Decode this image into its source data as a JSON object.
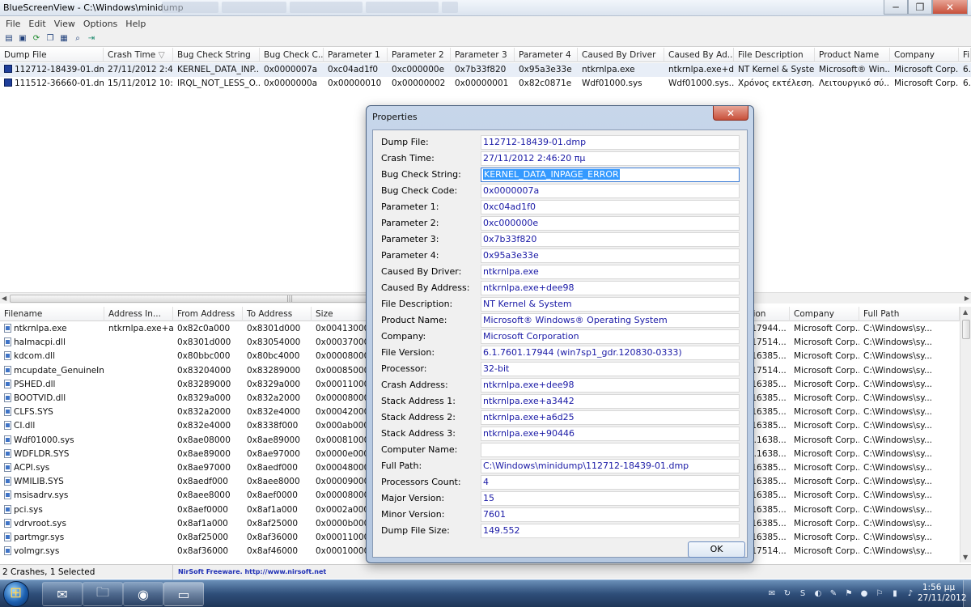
{
  "window": {
    "title": "BlueScreenView  -  C:\\Windows\\minidump",
    "minimize_glyph": "─",
    "maximize_glyph": "❐",
    "close_glyph": "✕"
  },
  "menu": [
    "File",
    "Edit",
    "View",
    "Options",
    "Help"
  ],
  "toolbar_icons": [
    "html-report-icon",
    "save-icon",
    "refresh-icon",
    "copy-icon",
    "properties-icon",
    "find-icon",
    "exit-icon"
  ],
  "upper_list": {
    "columns": [
      "Dump File",
      "Crash Time",
      "Bug Check String",
      "Bug Check C...",
      "Parameter 1",
      "Parameter 2",
      "Parameter 3",
      "Parameter 4",
      "Caused By Driver",
      "Caused By Ad...",
      "File Description",
      "Product Name",
      "Company",
      "Fi"
    ],
    "rows": [
      [
        "112712-18439-01.dmp",
        "27/11/2012 2:4...",
        "KERNEL_DATA_INP...",
        "0x0000007a",
        "0xc04ad1f0",
        "0xc000000e",
        "0x7b33f820",
        "0x95a3e33e",
        "ntkrnlpa.exe",
        "ntkrnlpa.exe+d...",
        "NT Kernel & Syste...",
        "Microsoft® Win...",
        "Microsoft Corp...",
        "6."
      ],
      [
        "111512-36660-01.dmp",
        "15/11/2012 10:...",
        "IRQL_NOT_LESS_O...",
        "0x0000000a",
        "0x00000010",
        "0x00000002",
        "0x00000001",
        "0x82c0871e",
        "Wdf01000.sys",
        "Wdf01000.sys...",
        "Χρόνος εκτέλεση...",
        "Λειτουργικό σύ...",
        "Microsoft Corp...",
        "6."
      ]
    ]
  },
  "hscroll_grip": "|||",
  "lower_list": {
    "columns": [
      "Filename",
      "Address In...",
      "From Address",
      "To Address",
      "Size",
      "sion",
      "Company",
      "Full Path"
    ],
    "rows": [
      [
        "ntkrnlpa.exe",
        "ntkrnlpa.exe+a...",
        "0x82c0a000",
        "0x8301d000",
        "0x00413000",
        ".17944...",
        "Microsoft Corp...",
        "C:\\Windows\\sy..."
      ],
      [
        "halmacpi.dll",
        "",
        "0x8301d000",
        "0x83054000",
        "0x00037000",
        ".17514...",
        "Microsoft Corp...",
        "C:\\Windows\\sy..."
      ],
      [
        "kdcom.dll",
        "",
        "0x80bbc000",
        "0x80bc4000",
        "0x00008000",
        ".16385...",
        "Microsoft Corp...",
        "C:\\Windows\\sy..."
      ],
      [
        "mcupdate_GenuineInt...",
        "",
        "0x83204000",
        "0x83289000",
        "0x00085000",
        ".17514...",
        "Microsoft Corp...",
        "C:\\Windows\\sy..."
      ],
      [
        "PSHED.dll",
        "",
        "0x83289000",
        "0x8329a000",
        "0x00011000",
        ".16385...",
        "Microsoft Corp...",
        "C:\\Windows\\sy..."
      ],
      [
        "BOOTVID.dll",
        "",
        "0x8329a000",
        "0x832a2000",
        "0x00008000",
        ".16385...",
        "Microsoft Corp...",
        "C:\\Windows\\sy..."
      ],
      [
        "CLFS.SYS",
        "",
        "0x832a2000",
        "0x832e4000",
        "0x00042000",
        ".16385...",
        "Microsoft Corp...",
        "C:\\Windows\\sy..."
      ],
      [
        "CI.dll",
        "",
        "0x832e4000",
        "0x8338f000",
        "0x000ab000",
        ".16385...",
        "Microsoft Corp...",
        "C:\\Windows\\sy..."
      ],
      [
        "Wdf01000.sys",
        "",
        "0x8ae08000",
        "0x8ae89000",
        "0x00081000",
        "0.1638...",
        "Microsoft Corp...",
        "C:\\Windows\\sy..."
      ],
      [
        "WDFLDR.SYS",
        "",
        "0x8ae89000",
        "0x8ae97000",
        "0x0000e000",
        "0.1638...",
        "Microsoft Corp...",
        "C:\\Windows\\sy..."
      ],
      [
        "ACPI.sys",
        "",
        "0x8ae97000",
        "0x8aedf000",
        "0x00048000",
        ".16385...",
        "Microsoft Corp...",
        "C:\\Windows\\sy..."
      ],
      [
        "WMILIB.SYS",
        "",
        "0x8aedf000",
        "0x8aee8000",
        "0x00009000",
        ".16385...",
        "Microsoft Corp...",
        "C:\\Windows\\sy..."
      ],
      [
        "msisadrv.sys",
        "",
        "0x8aee8000",
        "0x8aef0000",
        "0x00008000",
        ".16385...",
        "Microsoft Corp...",
        "C:\\Windows\\sy..."
      ],
      [
        "pci.sys",
        "",
        "0x8aef0000",
        "0x8af1a000",
        "0x0002a000",
        ".16385...",
        "Microsoft Corp...",
        "C:\\Windows\\sy..."
      ],
      [
        "vdrvroot.sys",
        "",
        "0x8af1a000",
        "0x8af25000",
        "0x0000b000",
        ".16385...",
        "Microsoft Corp...",
        "C:\\Windows\\sy..."
      ],
      [
        "partmgr.sys",
        "",
        "0x8af25000",
        "0x8af36000",
        "0x00011000",
        ".16385...",
        "Microsoft Corp...",
        "C:\\Windows\\sy..."
      ],
      [
        "volmgr.sys",
        "",
        "0x8af36000",
        "0x8af46000",
        "0x00010000",
        ".17514...",
        "Microsoft Corp...",
        "C:\\Windows\\sy..."
      ]
    ]
  },
  "status": {
    "count": "2 Crashes, 1 Selected",
    "credit": "NirSoft Freeware.  http://www.nirsoft.net"
  },
  "dialog": {
    "title": "Properties",
    "close_glyph": "✕",
    "ok_label": "OK",
    "properties": [
      {
        "label": "Dump File:",
        "value": "112712-18439-01.dmp"
      },
      {
        "label": "Crash Time:",
        "value": "27/11/2012 2:46:20 πμ"
      },
      {
        "label": "Bug Check String:",
        "value": "KERNEL_DATA_INPAGE_ERROR"
      },
      {
        "label": "Bug Check Code:",
        "value": "0x0000007a"
      },
      {
        "label": "Parameter 1:",
        "value": "0xc04ad1f0"
      },
      {
        "label": "Parameter 2:",
        "value": "0xc000000e"
      },
      {
        "label": "Parameter 3:",
        "value": "0x7b33f820"
      },
      {
        "label": "Parameter 4:",
        "value": "0x95a3e33e"
      },
      {
        "label": "Caused By Driver:",
        "value": "ntkrnlpa.exe"
      },
      {
        "label": "Caused By Address:",
        "value": "ntkrnlpa.exe+dee98"
      },
      {
        "label": "File Description:",
        "value": "NT Kernel & System"
      },
      {
        "label": "Product Name:",
        "value": "Microsoft® Windows® Operating System"
      },
      {
        "label": "Company:",
        "value": "Microsoft Corporation"
      },
      {
        "label": "File Version:",
        "value": "6.1.7601.17944 (win7sp1_gdr.120830-0333)"
      },
      {
        "label": "Processor:",
        "value": "32-bit"
      },
      {
        "label": "Crash Address:",
        "value": "ntkrnlpa.exe+dee98"
      },
      {
        "label": "Stack Address 1:",
        "value": "ntkrnlpa.exe+a3442"
      },
      {
        "label": "Stack Address 2:",
        "value": "ntkrnlpa.exe+a6d25"
      },
      {
        "label": "Stack Address 3:",
        "value": "ntkrnlpa.exe+90446"
      },
      {
        "label": "Computer Name:",
        "value": ""
      },
      {
        "label": "Full Path:",
        "value": "C:\\Windows\\minidump\\112712-18439-01.dmp"
      },
      {
        "label": "Processors Count:",
        "value": "4"
      },
      {
        "label": "Major Version:",
        "value": "15"
      },
      {
        "label": "Minor Version:",
        "value": "7601"
      },
      {
        "label": "Dump File Size:",
        "value": "149.552"
      }
    ]
  },
  "taskbar": {
    "time": "1:56 μμ",
    "date": "27/11/2012",
    "apps": [
      "outlook-icon",
      "explorer-folder-icon",
      "chrome-icon",
      "bluescreenview-icon"
    ]
  }
}
